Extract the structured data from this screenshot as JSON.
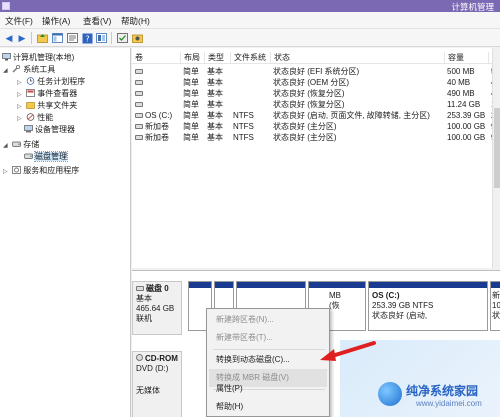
{
  "window": {
    "title": "计算机管理"
  },
  "menu": [
    {
      "label": "文件(F)"
    },
    {
      "label": "操作(A)"
    },
    {
      "label": "查看(V)"
    },
    {
      "label": "帮助(H)"
    }
  ],
  "tree": [
    {
      "label": "计算机管理(本地)",
      "icon": "computer-icon"
    },
    {
      "label": "系统工具",
      "icon": "tools-icon"
    },
    {
      "label": "任务计划程序",
      "icon": "clock-icon"
    },
    {
      "label": "事件查看器",
      "icon": "event-viewer-icon"
    },
    {
      "label": "共享文件夹",
      "icon": "shared-folder-icon"
    },
    {
      "label": "性能",
      "icon": "performance-icon"
    },
    {
      "label": "设备管理器",
      "icon": "device-manager-icon"
    },
    {
      "label": "存储",
      "icon": "storage-icon"
    },
    {
      "label": "磁盘管理",
      "icon": "disk-management-icon"
    },
    {
      "label": "服务和应用程序",
      "icon": "services-icon"
    }
  ],
  "table": {
    "columns": [
      "卷",
      "布局",
      "类型",
      "文件系统",
      "状态",
      "容量",
      "可"
    ],
    "rows": [
      {
        "vol": "",
        "layout": "简单",
        "type": "基本",
        "fs": "",
        "status": "状态良好 (EFI 系统分区)",
        "capacity": "500 MB",
        "free": "50"
      },
      {
        "vol": "",
        "layout": "简单",
        "type": "基本",
        "fs": "",
        "status": "状态良好 (OEM 分区)",
        "capacity": "40 MB",
        "free": "40"
      },
      {
        "vol": "",
        "layout": "简单",
        "type": "基本",
        "fs": "",
        "status": "状态良好 (恢复分区)",
        "capacity": "490 MB",
        "free": "49"
      },
      {
        "vol": "",
        "layout": "简单",
        "type": "基本",
        "fs": "",
        "status": "状态良好 (恢复分区)",
        "capacity": "11.24 GB",
        "free": "11"
      },
      {
        "vol": "OS (C:)",
        "layout": "简单",
        "type": "基本",
        "fs": "NTFS",
        "status": "状态良好 (启动, 页面文件, 故障转储, 主分区)",
        "capacity": "253.39 GB",
        "free": "22"
      },
      {
        "vol": "新加卷",
        "layout": "简单",
        "type": "基本",
        "fs": "NTFS",
        "status": "状态良好 (主分区)",
        "capacity": "100.00 GB",
        "free": "99"
      },
      {
        "vol": "新加卷",
        "layout": "简单",
        "type": "基本",
        "fs": "NTFS",
        "status": "状态良好 (主分区)",
        "capacity": "100.00 GB",
        "free": "99"
      }
    ]
  },
  "disk0": {
    "name": "磁盘 0",
    "type": "基本",
    "size": "465.64 GB",
    "state": "联机",
    "part_frag1": "MB",
    "part_frag2": "(恢",
    "os_name": "OS  (C:)",
    "os_size": "253.39 GB NTFS",
    "os_status": "状态良好 (启动,",
    "frag_a": "新",
    "frag_b": "10",
    "frag_c": "状"
  },
  "cdrom": {
    "name": "CD-ROM",
    "drive": "DVD (D:)",
    "state": "无媒体"
  },
  "context_menu": [
    {
      "label": "新建跨区卷(N)...",
      "enabled": false
    },
    {
      "label": "新建带区卷(T)...",
      "enabled": false
    },
    {
      "label": "转换到动态磁盘(C)...",
      "enabled": true
    },
    {
      "label": "转换成 MBR 磁盘(V)",
      "enabled": false
    },
    {
      "label": "属性(P)",
      "enabled": true
    },
    {
      "label": "帮助(H)",
      "enabled": true
    }
  ],
  "watermark": {
    "name": "纯净系统家园",
    "url": "www.yidaimei.com"
  },
  "colors": {
    "titlebar": "#7b6ab3",
    "partition_bar": "#1a3a8f",
    "annotation": "#e02020"
  }
}
